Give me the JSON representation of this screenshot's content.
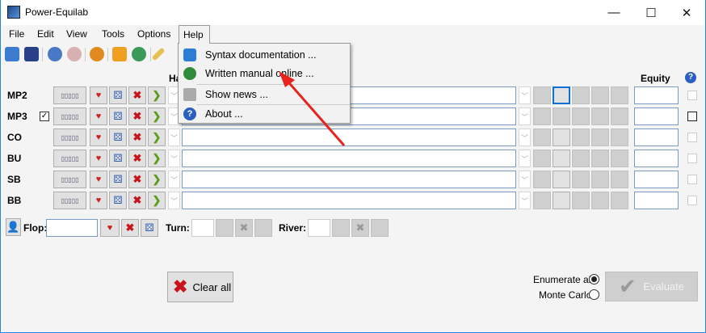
{
  "window": {
    "title": "Power-Equilab",
    "minimize": "—",
    "maximize": "☐",
    "close": "✕"
  },
  "menubar": [
    "File",
    "Edit",
    "View",
    "Tools",
    "Options",
    "Help"
  ],
  "help_menu": [
    {
      "label": "Syntax documentation ...",
      "icon": "book-icon",
      "color": "#2a7fd4"
    },
    {
      "label": "Written manual online ...",
      "icon": "globe-icon",
      "color": "#2e8b3a"
    },
    {
      "label": "Show news ...",
      "icon": "megaphone-icon",
      "color": "#999999"
    },
    {
      "label": "About ...",
      "icon": "help-circle-icon",
      "color": "#2a5fc0"
    }
  ],
  "hand_header": "Ha",
  "equity_header": "Equity",
  "help_glyph": "?",
  "players": [
    {
      "name": "MP2",
      "checked": false
    },
    {
      "name": "MP3",
      "checked": true
    },
    {
      "name": "CO",
      "checked": false
    },
    {
      "name": "BU",
      "checked": false
    },
    {
      "name": "SB",
      "checked": false
    },
    {
      "name": "BB",
      "checked": false
    }
  ],
  "board": {
    "flop_label": "Flop:",
    "turn_label": "Turn:",
    "river_label": "River:"
  },
  "clear_all": "Clear all",
  "options": {
    "enumerate": "Enumerate all",
    "monte_carlo": "Monte Carlo",
    "selected": "enumerate"
  },
  "evaluate": "Evaluate",
  "glyphs": {
    "x": "✖",
    "arrow": "❯",
    "chev": "﹀",
    "dice": "⚄",
    "card": "♥",
    "range": "▯▯▯▯▯"
  }
}
